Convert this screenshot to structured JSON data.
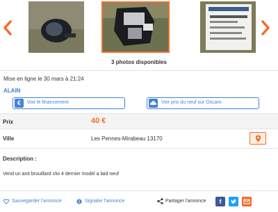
{
  "gallery": {
    "photo_count_label": "3 photos disponibles",
    "accent": "#f56b2a"
  },
  "listing": {
    "posted": "Mise en ligne le 30 mars à 21:24",
    "seller": "ALAIN",
    "finance_button": "Voir le financement",
    "oscaro_button": "Voir prix du neuf sur Oscaro",
    "price_label": "Prix",
    "price": "40 €",
    "city_label": "Ville",
    "city": "Les Pennes-Mirabeau 13170",
    "description_title": "Description :",
    "description": "Vend un anti brouillard clio 4 dernier model a laid neuf"
  },
  "footer": {
    "save": "Sauvegarder l'annonce",
    "report": "Signaler l'annonce",
    "share": "Partager l'annonce"
  },
  "colors": {
    "link_blue": "#4183d7",
    "orange": "#f56b2a",
    "facebook": "#3b5998",
    "twitter": "#1da1f2"
  },
  "icons": {
    "prev": "chevron-left-icon",
    "next": "chevron-right-icon",
    "finance": "euro-icon",
    "oscaro": "car-icon",
    "map": "map-pin-icon",
    "save": "heart-icon",
    "report": "info-icon",
    "share": "share-icon"
  }
}
